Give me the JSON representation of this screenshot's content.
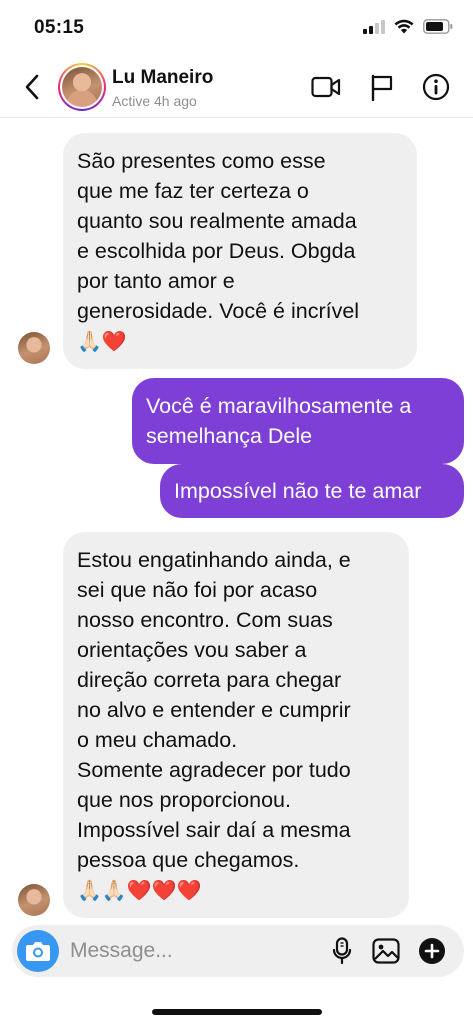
{
  "status_bar": {
    "time": "05:15"
  },
  "header": {
    "contact_name": "Lu Maneiro",
    "contact_status": "Active 4h ago"
  },
  "messages": [
    {
      "direction": "incoming",
      "lines": [
        "São presentes como esse",
        "que me faz ter certeza o",
        "quanto sou realmente amada",
        "e escolhida por Deus. Obgda",
        "por tanto amor e",
        "generosidade. Você é incrível"
      ],
      "emojis": [
        "🙏🏻",
        "❤️"
      ]
    },
    {
      "direction": "outgoing",
      "lines": [
        "Você é maravilhosamente a",
        "semelhança Dele"
      ]
    },
    {
      "direction": "outgoing",
      "lines": [
        "Impossível não te te amar"
      ]
    },
    {
      "direction": "incoming",
      "lines": [
        "Estou engatinhando ainda, e",
        "sei que não foi por acaso",
        "nosso encontro. Com suas",
        "orientações vou saber a",
        "direção correta para chegar",
        "no alvo e entender e cumprir",
        "o meu chamado.",
        "Somente agradecer por tudo",
        "que nos proporcionou.",
        "Impossível sair daí a mesma",
        "pessoa que chegamos."
      ],
      "emojis": [
        "🙏🏻",
        "🙏🏻",
        "❤️",
        "❤️",
        "❤️"
      ]
    }
  ],
  "composer": {
    "placeholder": "Message..."
  },
  "colors": {
    "outgoing_bubble": "#7e3fd7",
    "incoming_bubble": "#efefef",
    "camera_button": "#3897f0"
  }
}
